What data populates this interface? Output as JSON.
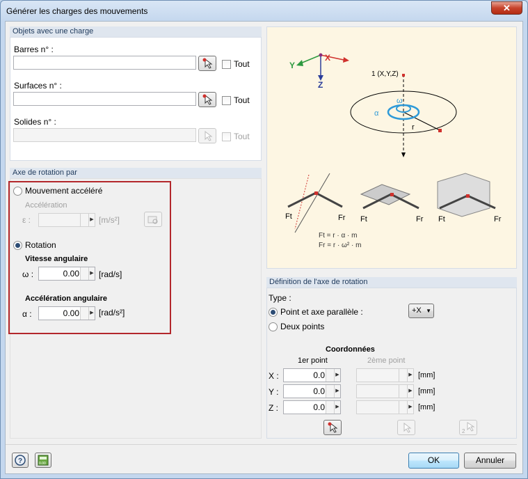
{
  "window": {
    "title": "Générer les charges des mouvements",
    "close": "✕"
  },
  "objets": {
    "header": "Objets avec une charge",
    "barres": {
      "label": "Barres n° :",
      "value": "",
      "tout": "Tout"
    },
    "surfaces": {
      "label": "Surfaces n° :",
      "value": "",
      "tout": "Tout"
    },
    "solides": {
      "label": "Solides n° :",
      "value": "",
      "tout": "Tout"
    }
  },
  "axe": {
    "header": "Axe de rotation par",
    "mouvement": "Mouvement accéléré",
    "acceleration": "Accélération",
    "eps_label": "ε :",
    "eps_unit": "[m/s²]",
    "rotation": "Rotation",
    "vitesse": "Vitesse angulaire",
    "omega_label": "ω :",
    "omega_value": "0.00",
    "omega_unit": "[rad/s]",
    "acc_ang": "Accélération angulaire",
    "alpha_label": "α :",
    "alpha_value": "0.00",
    "alpha_unit": "[rad/s²]"
  },
  "illustration": {
    "axis_x": "X",
    "axis_y": "Y",
    "axis_z": "Z",
    "point": "1 (X,Y,Z)",
    "omega": "ω",
    "alpha": "α",
    "r": "r",
    "ft": "Ft",
    "fr": "Fr",
    "formula1": "Ft = r · α · m",
    "formula2": "Fr = r · ω² · m"
  },
  "definition": {
    "header": "Définition de l'axe de rotation",
    "type": "Type :",
    "point_axe": "Point et axe parallèle :",
    "axis_select": "+X",
    "deux_points": "Deux points",
    "coords": "Coordonnées",
    "p1": "1er point",
    "p2": "2ème point",
    "x": "X :",
    "y": "Y :",
    "z": "Z :",
    "x1": "0.0",
    "y1": "0.0",
    "z1": "0.0",
    "unit": "[mm]"
  },
  "footer": {
    "ok": "OK",
    "cancel": "Annuler"
  }
}
